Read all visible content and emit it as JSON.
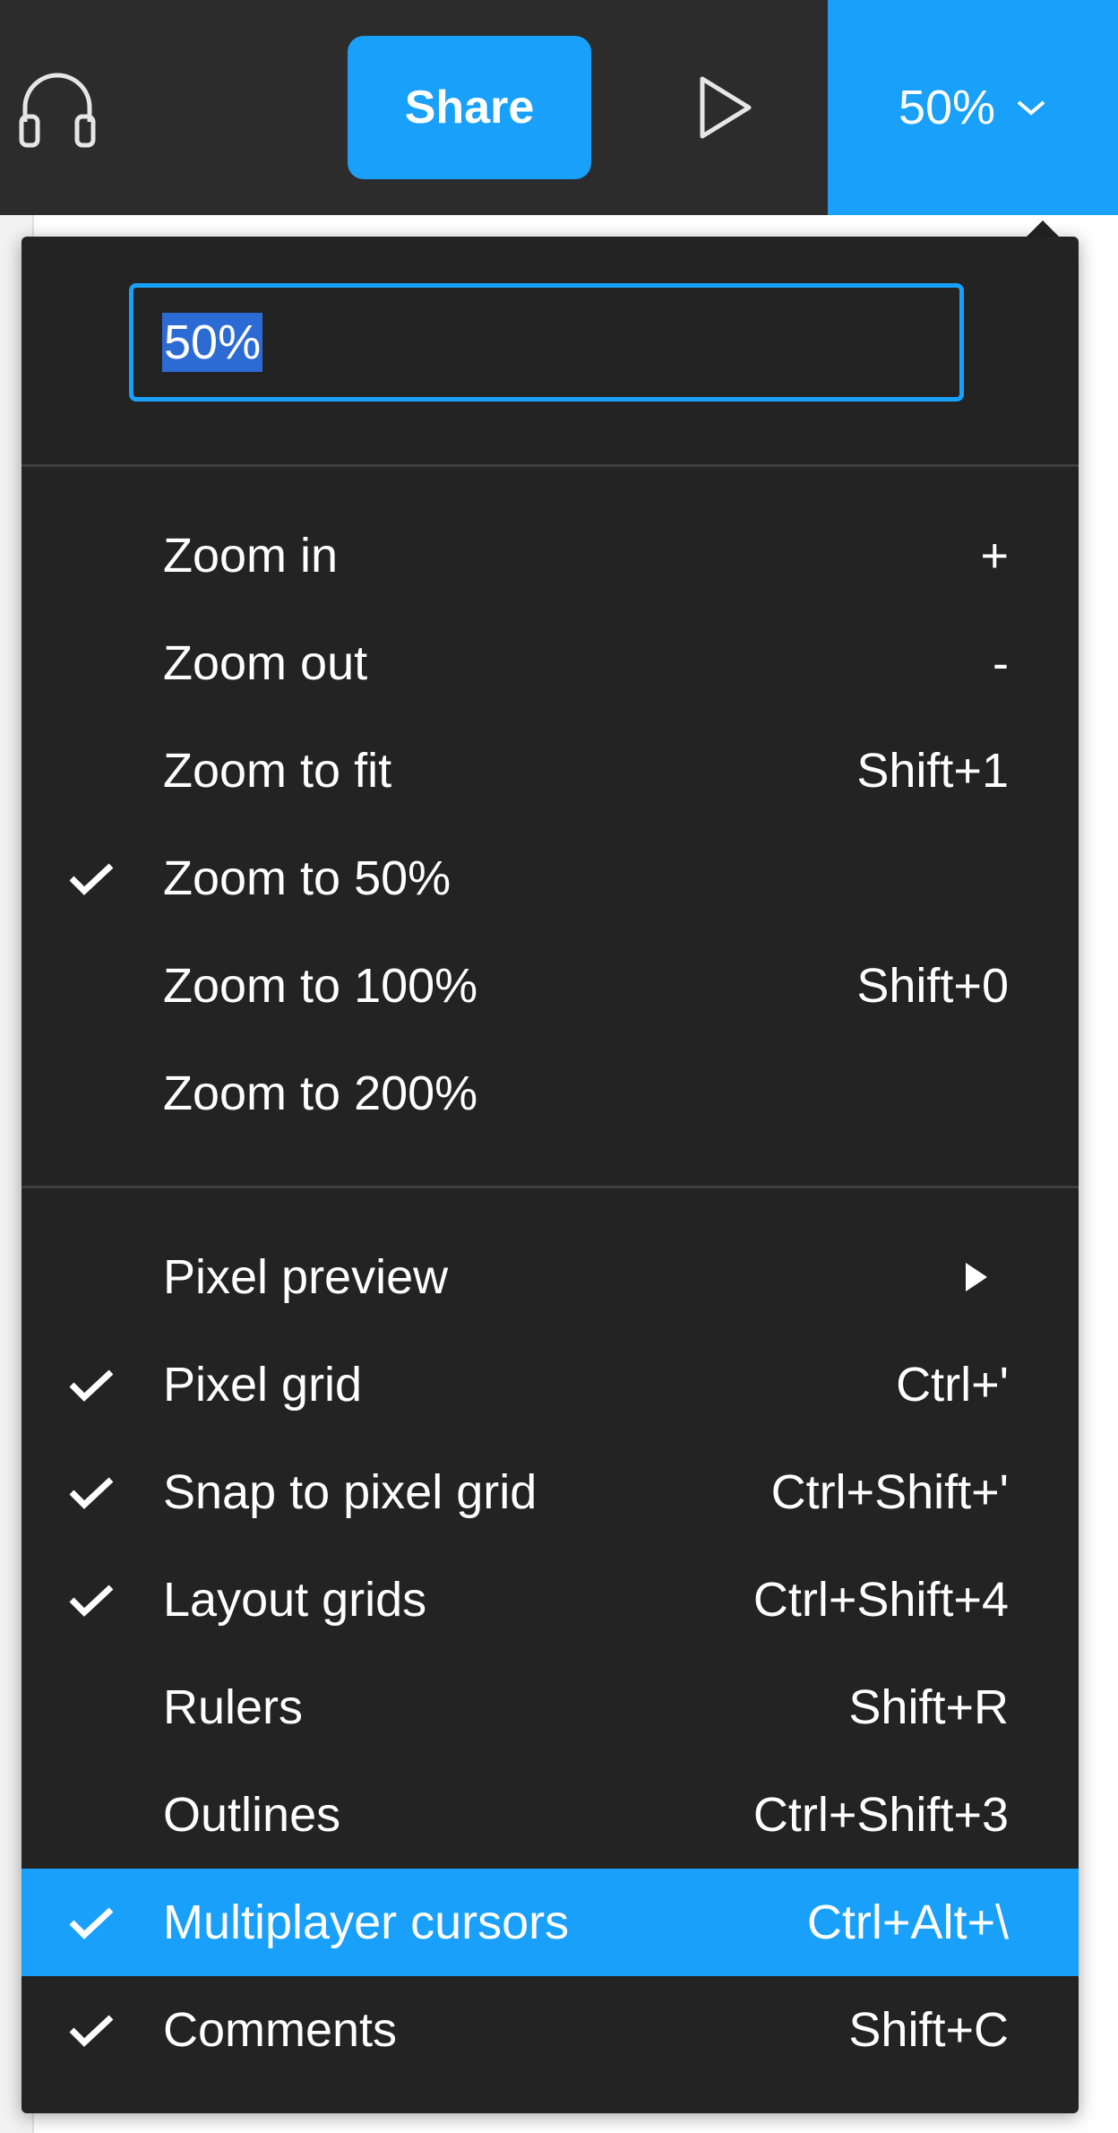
{
  "toolbar": {
    "share_label": "Share",
    "zoom_label": "50%",
    "headphones_icon": "headphones-icon",
    "play_icon": "play-icon",
    "chevron_icon": "chevron-down-icon"
  },
  "colors": {
    "accent": "#18a0fb",
    "toolbar_bg": "#2c2c2c",
    "menu_bg": "#232323",
    "separator": "#3f3f3f"
  },
  "menu": {
    "zoom_input_value": "50%",
    "group1": [
      {
        "label": "Zoom in",
        "shortcut": "+",
        "checked": false
      },
      {
        "label": "Zoom out",
        "shortcut": "-",
        "checked": false
      },
      {
        "label": "Zoom to fit",
        "shortcut": "Shift+1",
        "checked": false
      },
      {
        "label": "Zoom to 50%",
        "shortcut": "",
        "checked": true
      },
      {
        "label": "Zoom to 100%",
        "shortcut": "Shift+0",
        "checked": false
      },
      {
        "label": "Zoom to 200%",
        "shortcut": "",
        "checked": false
      }
    ],
    "group2": [
      {
        "label": "Pixel preview",
        "shortcut": "",
        "checked": false,
        "submenu": true
      },
      {
        "label": "Pixel grid",
        "shortcut": "Ctrl+'",
        "checked": true
      },
      {
        "label": "Snap to pixel grid",
        "shortcut": "Ctrl+Shift+'",
        "checked": true
      },
      {
        "label": "Layout grids",
        "shortcut": "Ctrl+Shift+4",
        "checked": true
      },
      {
        "label": "Rulers",
        "shortcut": "Shift+R",
        "checked": false
      },
      {
        "label": "Outlines",
        "shortcut": "Ctrl+Shift+3",
        "checked": false
      },
      {
        "label": "Multiplayer cursors",
        "shortcut": "Ctrl+Alt+\\",
        "checked": true,
        "highlighted": true
      },
      {
        "label": "Comments",
        "shortcut": "Shift+C",
        "checked": true
      }
    ]
  }
}
